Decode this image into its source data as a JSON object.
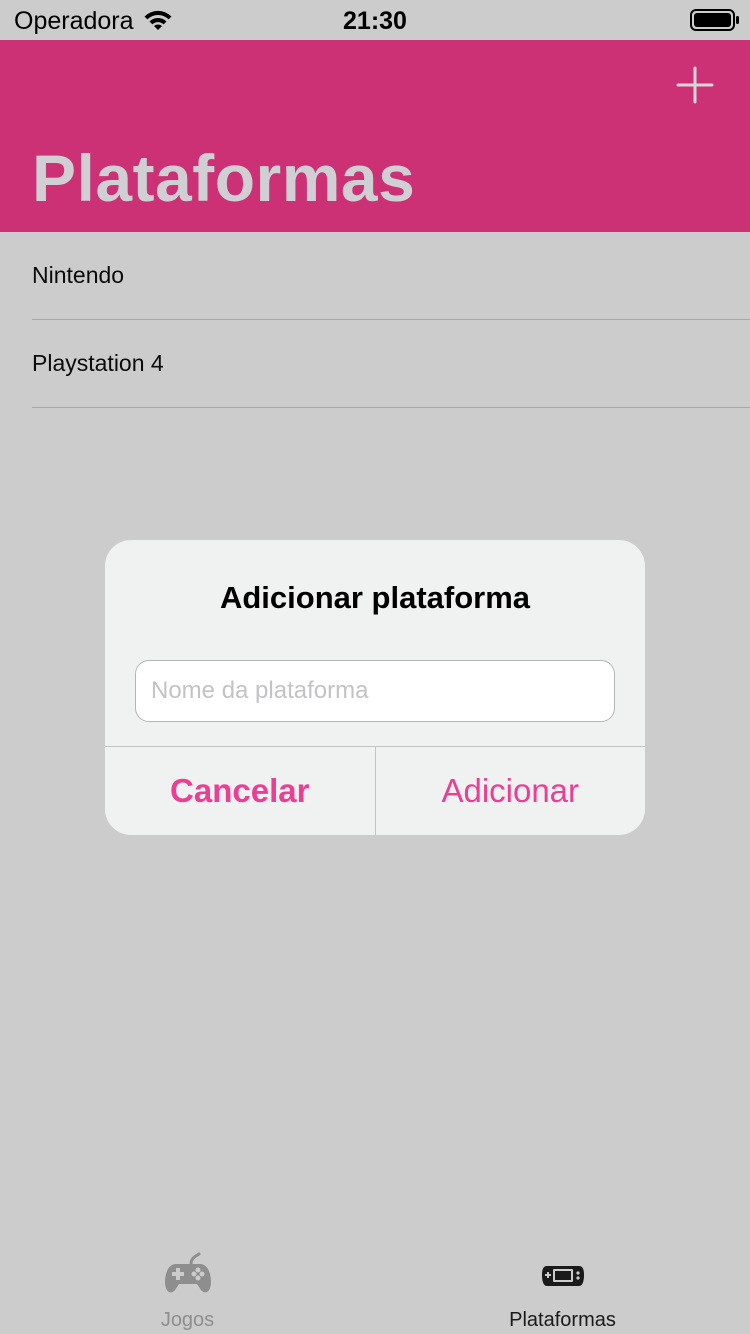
{
  "status_bar": {
    "carrier": "Operadora",
    "time": "21:30"
  },
  "header": {
    "title": "Plataformas",
    "add_icon": "plus-icon"
  },
  "platforms": [
    {
      "label": "Nintendo"
    },
    {
      "label": "Playstation 4"
    }
  ],
  "alert": {
    "title": "Adicionar plataforma",
    "input_value": "",
    "input_placeholder": "Nome da plataforma",
    "cancel_label": "Cancelar",
    "confirm_label": "Adicionar"
  },
  "tabs": [
    {
      "label": "Jogos",
      "icon": "gamepad-icon",
      "active": false
    },
    {
      "label": "Plataformas",
      "icon": "handheld-console-icon",
      "active": true
    }
  ],
  "colors": {
    "accent": "#cc3075",
    "button_tint": "#ea3f93",
    "background": "#cccccc"
  }
}
